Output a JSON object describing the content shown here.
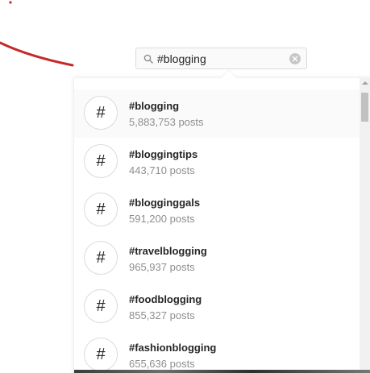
{
  "search": {
    "value": "#blogging"
  },
  "results": [
    {
      "icon": "#",
      "name": "#blogging",
      "count": "5,883,753 posts"
    },
    {
      "icon": "#",
      "name": "#bloggingtips",
      "count": "443,710 posts"
    },
    {
      "icon": "#",
      "name": "#blogginggals",
      "count": "591,200 posts"
    },
    {
      "icon": "#",
      "name": "#travelblogging",
      "count": "965,937 posts"
    },
    {
      "icon": "#",
      "name": "#foodblogging",
      "count": "855,327 posts"
    },
    {
      "icon": "#",
      "name": "#fashionblogging",
      "count": "655,636 posts"
    }
  ],
  "colors": {
    "annotation": "#c62828",
    "tag_text": "#262626",
    "count_text": "#8e8e8e",
    "border": "#dbdbdb"
  },
  "icons": {
    "search": "search-icon",
    "clear": "clear-icon",
    "hashtag": "hashtag-icon"
  }
}
